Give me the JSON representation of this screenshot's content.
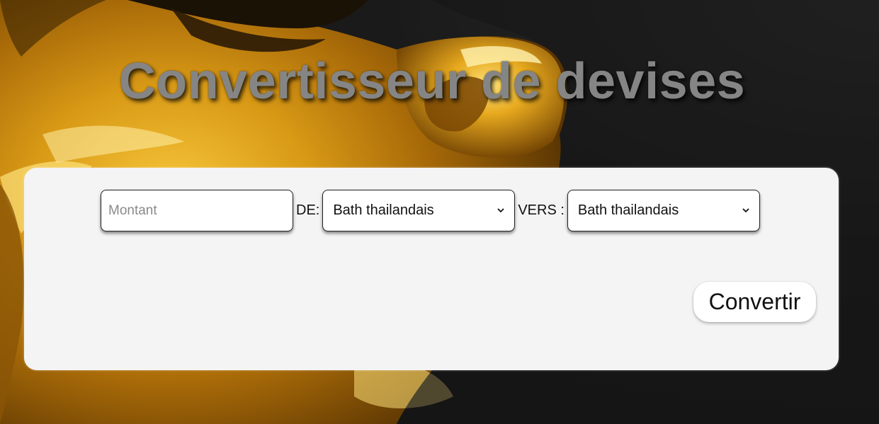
{
  "page": {
    "title": "Convertisseur de devises"
  },
  "converter": {
    "amount_placeholder": "Montant",
    "amount_value": "",
    "from_label": "DE:",
    "from_selected": "Bath thailandais",
    "to_label": "VERS :",
    "to_selected": "Bath thailandais",
    "convert_button": "Convertir"
  },
  "colors": {
    "background_dark": "#151515",
    "background_gold": "#d99a16",
    "title_gray": "#858585",
    "panel": "#f4f4f5"
  },
  "icons": {
    "select_arrow": "chevron-down-icon"
  }
}
